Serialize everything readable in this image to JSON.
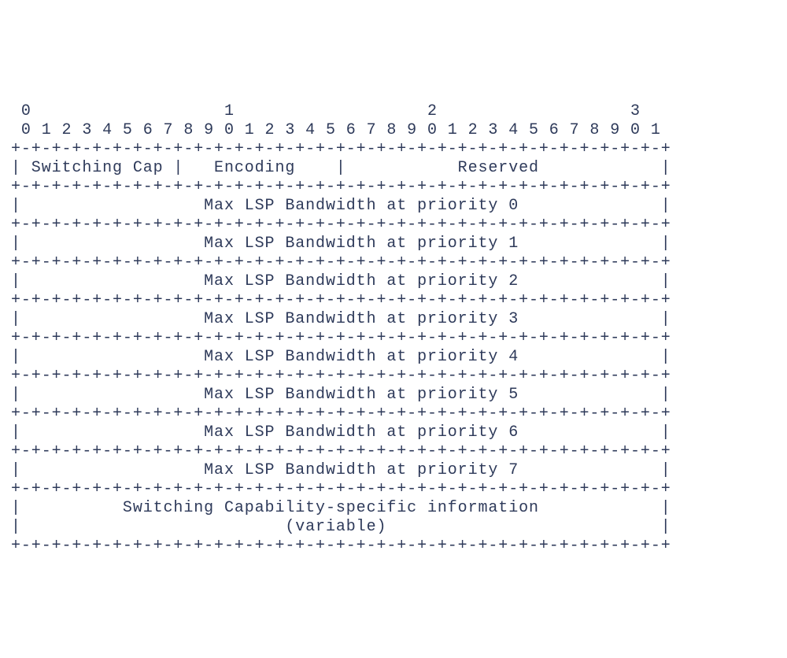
{
  "diagram": {
    "total_bits": 32,
    "bit_header": {
      "tens_row": " 0                   1                   2                   3",
      "units_row": " 0 1 2 3 4 5 6 7 8 9 0 1 2 3 4 5 6 7 8 9 0 1 2 3 4 5 6 7 8 9 0 1"
    },
    "border": "+-+-+-+-+-+-+-+-+-+-+-+-+-+-+-+-+-+-+-+-+-+-+-+-+-+-+-+-+-+-+-+-+",
    "rows": [
      {
        "fields": [
          {
            "name": "Switching Cap",
            "bits": "0-7",
            "width_bits": 8
          },
          {
            "name": "Encoding",
            "bits": "8-15",
            "width_bits": 8
          },
          {
            "name": "Reserved",
            "bits": "16-31",
            "width_bits": 16
          }
        ],
        "text": "| Switching Cap |   Encoding    |           Reserved            |"
      },
      {
        "fields": [
          {
            "name": "Max LSP Bandwidth at priority 0",
            "width_bits": 32
          }
        ],
        "text": "|                  Max LSP Bandwidth at priority 0              |"
      },
      {
        "fields": [
          {
            "name": "Max LSP Bandwidth at priority 1",
            "width_bits": 32
          }
        ],
        "text": "|                  Max LSP Bandwidth at priority 1              |"
      },
      {
        "fields": [
          {
            "name": "Max LSP Bandwidth at priority 2",
            "width_bits": 32
          }
        ],
        "text": "|                  Max LSP Bandwidth at priority 2              |"
      },
      {
        "fields": [
          {
            "name": "Max LSP Bandwidth at priority 3",
            "width_bits": 32
          }
        ],
        "text": "|                  Max LSP Bandwidth at priority 3              |"
      },
      {
        "fields": [
          {
            "name": "Max LSP Bandwidth at priority 4",
            "width_bits": 32
          }
        ],
        "text": "|                  Max LSP Bandwidth at priority 4              |"
      },
      {
        "fields": [
          {
            "name": "Max LSP Bandwidth at priority 5",
            "width_bits": 32
          }
        ],
        "text": "|                  Max LSP Bandwidth at priority 5              |"
      },
      {
        "fields": [
          {
            "name": "Max LSP Bandwidth at priority 6",
            "width_bits": 32
          }
        ],
        "text": "|                  Max LSP Bandwidth at priority 6              |"
      },
      {
        "fields": [
          {
            "name": "Max LSP Bandwidth at priority 7",
            "width_bits": 32
          }
        ],
        "text": "|                  Max LSP Bandwidth at priority 7              |"
      },
      {
        "fields": [
          {
            "name": "Switching Capability-specific information (variable)",
            "width_bits": 32
          }
        ],
        "lines": [
          "|          Switching Capability-specific information            |",
          "|                          (variable)                           |"
        ]
      }
    ]
  }
}
